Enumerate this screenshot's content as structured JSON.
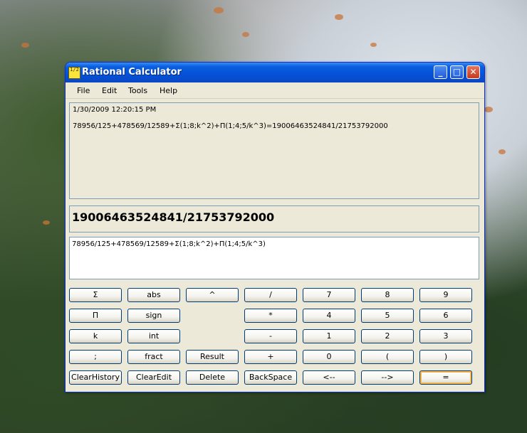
{
  "window": {
    "title": "Rational Calculator",
    "icon_text": "1/2",
    "controls": {
      "minimize": "_",
      "maximize": "□",
      "close": "✕"
    }
  },
  "menu": [
    "File",
    "Edit",
    "Tools",
    "Help"
  ],
  "history": {
    "timestamp": "1/30/2009 12:20:15 PM",
    "entry": "78956/125+478569/12589+Σ(1;8;k^2)+Π(1;4;5/k^3)=19006463524841/21753792000"
  },
  "result": "19006463524841/21753792000",
  "editor_text": "78956/125+478569/12589+Σ(1;8;k^2)+Π(1;4;5/k^3)",
  "keypad": {
    "rows": [
      [
        "Σ",
        "abs",
        "^",
        "/",
        "7",
        "8",
        "9"
      ],
      [
        "Π",
        "sign",
        "",
        "*",
        "4",
        "5",
        "6"
      ],
      [
        "k",
        "int",
        "",
        "-",
        "1",
        "2",
        "3"
      ],
      [
        ";",
        "fract",
        "Result",
        "+",
        "0",
        "(",
        ")"
      ],
      [
        "ClearHistory",
        "ClearEdit",
        "Delete",
        "BackSpace",
        "<--",
        "-->",
        "="
      ]
    ]
  },
  "colors": {
    "title_bar": "#0551d8",
    "window_bg": "#ece9d8",
    "border": "#0831d9",
    "default_button_glow": "#f5b852"
  }
}
